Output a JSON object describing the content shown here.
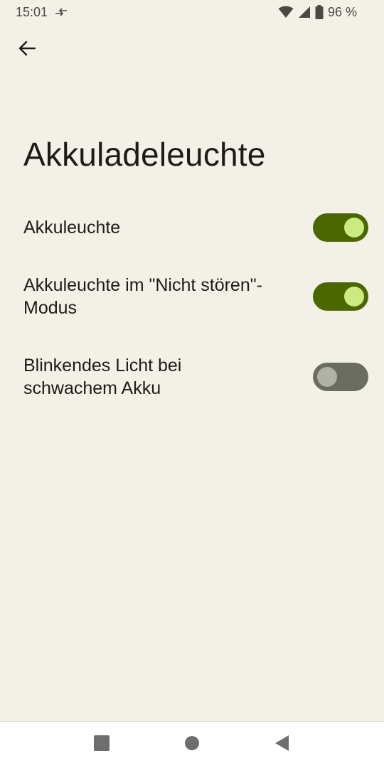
{
  "status_bar": {
    "time": "15:01",
    "battery_percent": "96 %",
    "icons": [
      "data-transfer-icon",
      "wifi-icon",
      "signal-icon",
      "battery-icon"
    ]
  },
  "header": {
    "back_icon": "arrow-back-icon"
  },
  "page": {
    "title": "Akkuladeleuchte"
  },
  "settings": [
    {
      "label": "Akkuleuchte",
      "enabled": true
    },
    {
      "label": "Akkuleuchte im \"Nicht stören\"-Modus",
      "enabled": true
    },
    {
      "label": "Blinkendes Licht bei schwachem Akku",
      "enabled": false
    }
  ],
  "nav_bar": {
    "icons": [
      "recents-square-icon",
      "home-circle-icon",
      "back-triangle-icon"
    ]
  },
  "colors": {
    "background": "#f3f0e8",
    "switch_on_track": "#4b6700",
    "switch_on_thumb": "#cbea83",
    "switch_off_track": "#6b6d62",
    "switch_off_thumb": "#b0b1a7"
  }
}
